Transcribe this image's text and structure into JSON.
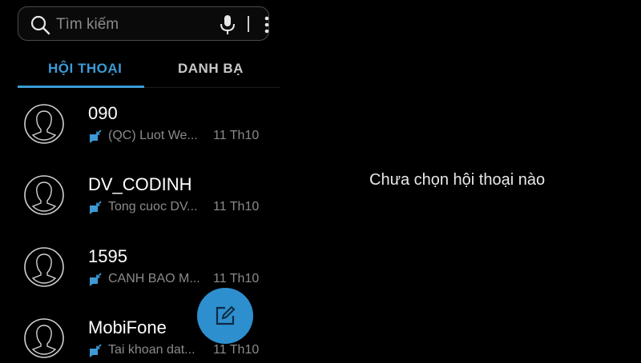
{
  "search": {
    "placeholder": "Tìm kiếm"
  },
  "tabs": [
    {
      "label": "HỘI THOẠI",
      "active": true
    },
    {
      "label": "DANH BẠ",
      "active": false
    }
  ],
  "conversations": [
    {
      "name": "090",
      "preview": "(QC) Luot We...",
      "date": "11 Th10"
    },
    {
      "name": "DV_CODINH",
      "preview": "Tong cuoc DV...",
      "date": "11 Th10"
    },
    {
      "name": "1595",
      "preview": "CANH BAO M...",
      "date": "11 Th10"
    },
    {
      "name": "MobiFone",
      "preview": "Tai khoan dat...",
      "date": "11 Th10"
    }
  ],
  "detail": {
    "empty_message": "Chưa chọn hội thoại nào"
  },
  "colors": {
    "accent": "#3d9ad6",
    "fab": "#2e8fcf",
    "background": "#000000"
  },
  "icons": [
    "search-icon",
    "mic-icon",
    "more-icon",
    "avatar-icon",
    "message-icon",
    "compose-icon"
  ]
}
